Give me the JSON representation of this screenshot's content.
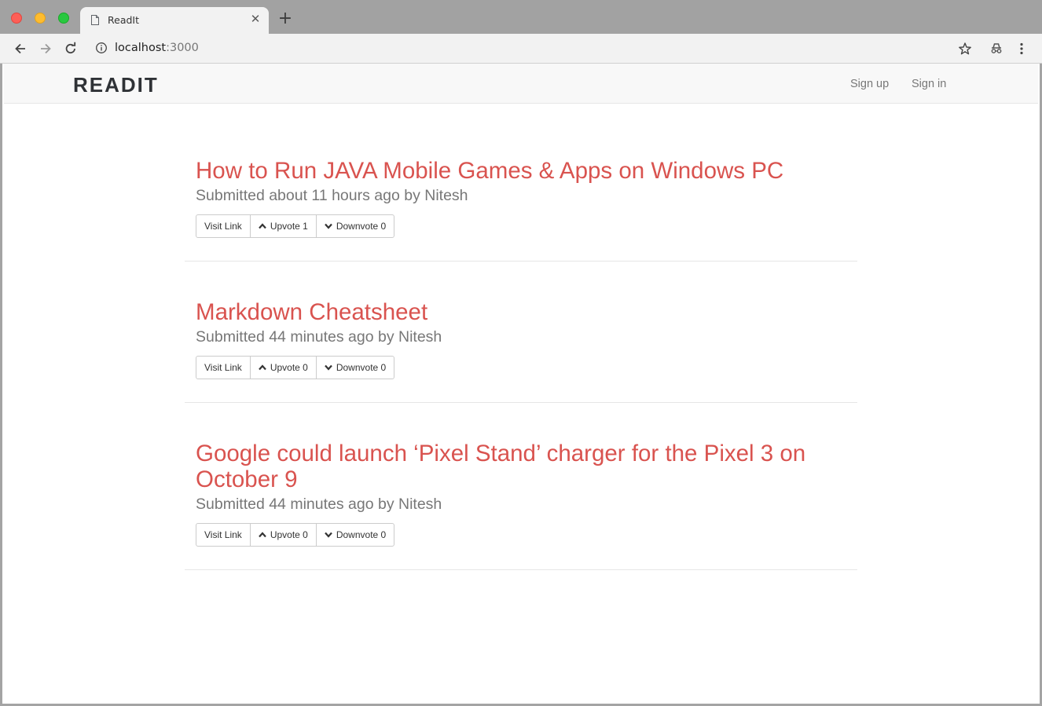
{
  "browser": {
    "tab_title": "ReadIt",
    "address_host": "localhost",
    "address_port": ":3000"
  },
  "app": {
    "brand": "READIT",
    "nav": {
      "signup": "Sign up",
      "signin": "Sign in"
    },
    "links": [
      {
        "title": "How to Run JAVA Mobile Games & Apps on Windows PC",
        "meta": "Submitted about 11 hours ago by Nitesh",
        "visit": "Visit Link",
        "upvote": "Upvote 1",
        "downvote": "Downvote 0"
      },
      {
        "title": "Markdown Cheatsheet",
        "meta": "Submitted 44 minutes ago by Nitesh",
        "visit": "Visit Link",
        "upvote": "Upvote 0",
        "downvote": "Downvote 0"
      },
      {
        "title": "Google could launch ‘Pixel Stand’ charger for the Pixel 3 on October 9",
        "meta": "Submitted 44 minutes ago by Nitesh",
        "visit": "Visit Link",
        "upvote": "Upvote 0",
        "downvote": "Downvote 0"
      }
    ]
  },
  "colors": {
    "link_title": "#d9534f",
    "meta_text": "#777777"
  }
}
